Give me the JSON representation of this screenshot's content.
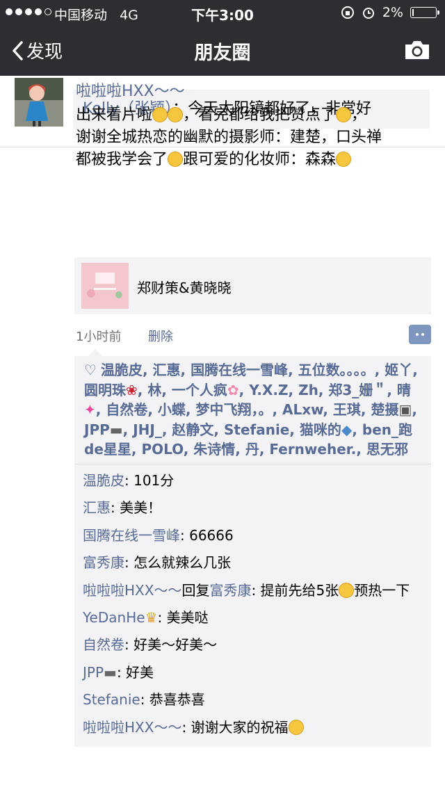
{
  "status_bar": {
    "carrier": "中国移动",
    "network": "4G",
    "time": "下午3:00",
    "battery": "2%"
  },
  "nav": {
    "back_label": "发现",
    "title": "朋友圈"
  },
  "top_comment": {
    "name": "Kelly（张颖）",
    "text": "：今天太阳镜都好了，非常好"
  },
  "post": {
    "author": "啦啦啦HXX～～",
    "text_line1": "出来看片啦",
    "text_line1b": "，看完都给我把赞点了",
    "text_line1c": "，",
    "text_line2": "谢谢全城热恋的幽默的摄影师：建楚，口头禅",
    "text_line3": "都被我学会了",
    "text_line3b": "跟可爱的化妆师：森森",
    "link_title": "郑财策&黄晓晓",
    "time": "1小时前",
    "delete": "删除"
  },
  "likes": {
    "names": [
      "温脆皮",
      "汇惠",
      "国腾在线一雪峰",
      "五位数。。。。",
      "姬丫",
      "圆明珠",
      "林",
      "一个人疯",
      "Y.X.Z",
      "Zh",
      "郑3_姗＂",
      "晴",
      "自然卷",
      "小蝶",
      "梦中飞翔，。",
      "ALxw",
      "王琪",
      "楚摄",
      "JPP",
      "JHJ_",
      "赵静文",
      "Stefanie",
      "猫咪的",
      "ben_跑de星星",
      "POLO",
      "朱诗情",
      "丹",
      "Fernweher.",
      "思无邪"
    ]
  },
  "comments": [
    {
      "name": "温脆皮",
      "text": ": 101分"
    },
    {
      "name": "汇惠",
      "text": ": 美美！"
    },
    {
      "name": "国腾在线一雪峰",
      "text": ": 66666"
    },
    {
      "name": "富秀康",
      "text": ": 怎么就辣么几张"
    },
    {
      "name": "啦啦啦HXX～～",
      "reply_word": "回复",
      "reply_to": "富秀康",
      "text": ": 提前先给5张",
      "text_after": "预热一下"
    },
    {
      "name": "YeDanHe",
      "text": ": 美美哒"
    },
    {
      "name": "自然卷",
      "text": ": 好美～好美～"
    },
    {
      "name": "JPP",
      "text": ": 好美"
    },
    {
      "name": "Stefanie",
      "text": ": 恭喜恭喜"
    },
    {
      "name": "啦啦啦HXX～～",
      "text": ": 谢谢大家的祝福"
    }
  ],
  "colors": {
    "nav_bg": "#2e2d32",
    "link_blue": "#576b95",
    "comment_bg": "#f3f3f5"
  }
}
